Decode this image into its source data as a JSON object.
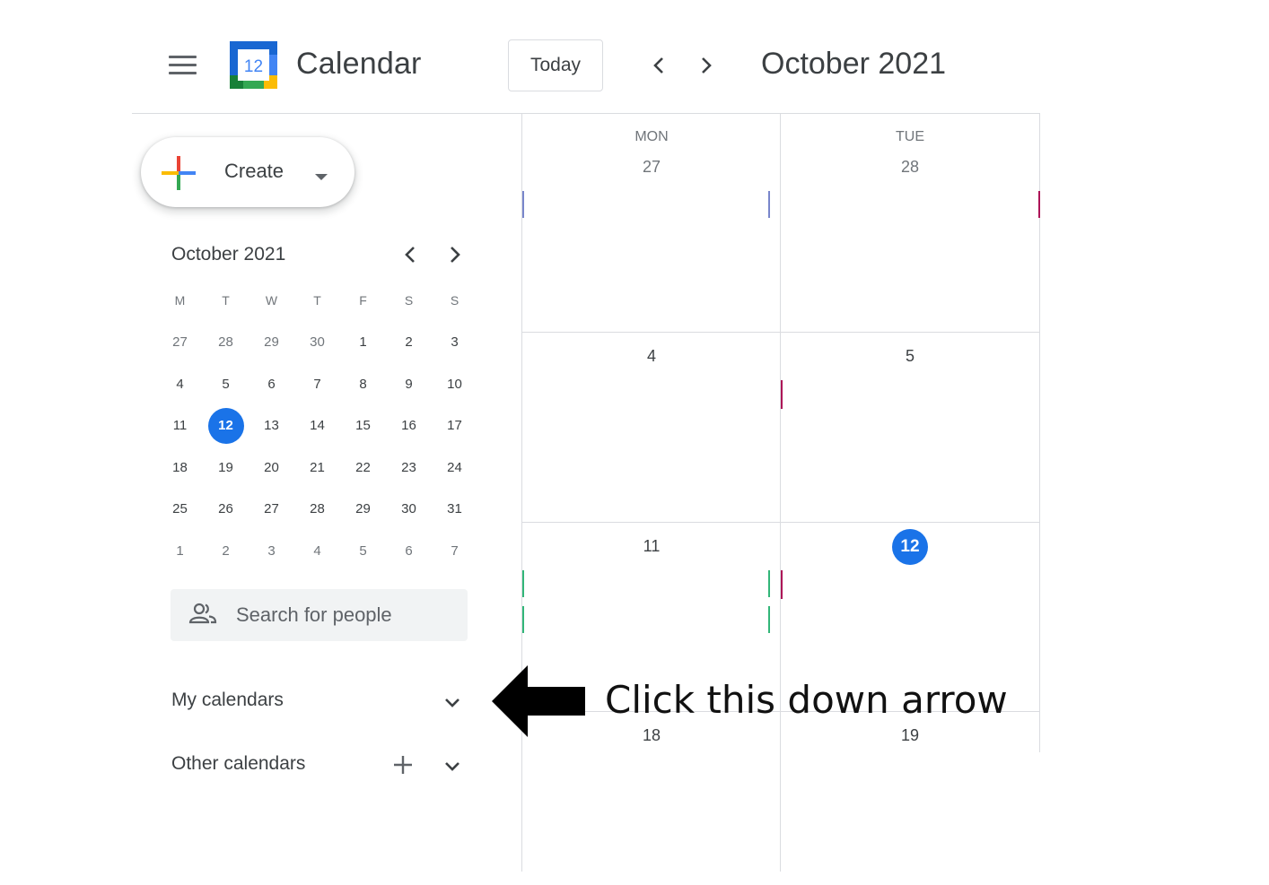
{
  "header": {
    "app_title": "Calendar",
    "logo_day": "12",
    "today_label": "Today",
    "month_title": "October 2021"
  },
  "create": {
    "label": "Create"
  },
  "mini_calendar": {
    "title": "October 2021",
    "weekday_heads": [
      "M",
      "T",
      "W",
      "T",
      "F",
      "S",
      "S"
    ],
    "weeks": [
      [
        "27",
        "28",
        "29",
        "30",
        "1",
        "2",
        "3"
      ],
      [
        "4",
        "5",
        "6",
        "7",
        "8",
        "9",
        "10"
      ],
      [
        "11",
        "12",
        "13",
        "14",
        "15",
        "16",
        "17"
      ],
      [
        "18",
        "19",
        "20",
        "21",
        "22",
        "23",
        "24"
      ],
      [
        "25",
        "26",
        "27",
        "28",
        "29",
        "30",
        "31"
      ],
      [
        "1",
        "2",
        "3",
        "4",
        "5",
        "6",
        "7"
      ]
    ],
    "today": "12"
  },
  "search": {
    "placeholder": "Search for people"
  },
  "sections": {
    "my_calendars": "My calendars",
    "other_calendars": "Other calendars"
  },
  "grid": {
    "columns": [
      {
        "dow": "MON",
        "dates": [
          "27",
          "4",
          "11",
          "18"
        ]
      },
      {
        "dow": "TUE",
        "dates": [
          "28",
          "5",
          "12",
          "19"
        ]
      }
    ],
    "today_date": "12"
  },
  "annotation": {
    "text": "Click this down arrow"
  },
  "colors": {
    "accent": "#1a73e8",
    "event_purple": "#7986cb",
    "event_magenta": "#ad1457",
    "event_green": "#33b679"
  }
}
